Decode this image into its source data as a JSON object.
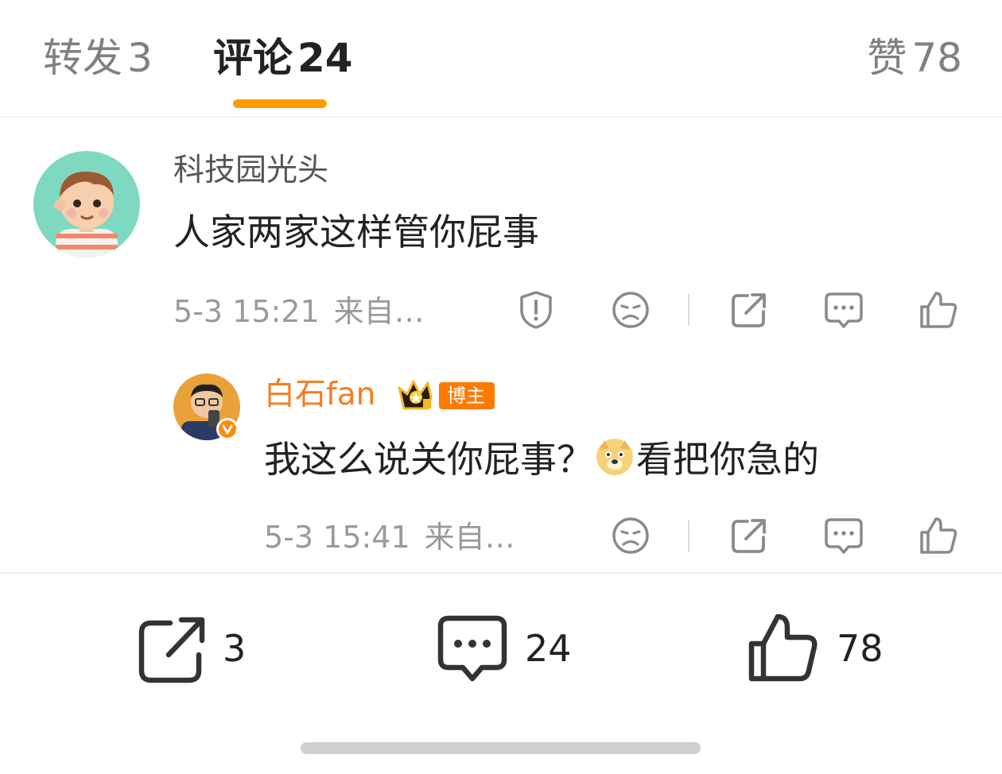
{
  "tabs": {
    "repost": {
      "label": "转发",
      "count": "3"
    },
    "comments": {
      "label": "评论",
      "count": "24"
    },
    "likes": {
      "label": "赞",
      "count": "78"
    }
  },
  "comments": [
    {
      "username": "科技园光头",
      "text": "人家两家这样管你屁事",
      "time": "5-3 15:21",
      "source": "来自…",
      "actions": [
        "report-icon",
        "dislike-icon",
        "share-icon",
        "comment-icon",
        "like-icon"
      ]
    }
  ],
  "reply": {
    "username": "白石fan",
    "badge": "博主",
    "text_before": "我这么说关你屁事？",
    "emoji": "doge-emoji",
    "text_after": "看把你急的",
    "time": "5-3 15:41",
    "source": "来自…",
    "actions": [
      "dislike-icon",
      "share-icon",
      "comment-icon",
      "like-icon"
    ]
  },
  "bottom_bar": {
    "repost_count": "3",
    "comment_count": "24",
    "like_count": "78"
  },
  "colors": {
    "accent": "#ff9d00",
    "blogger_name": "#f57c1f",
    "badge": "#ff7a00",
    "muted_text": "#9a9a9a"
  }
}
